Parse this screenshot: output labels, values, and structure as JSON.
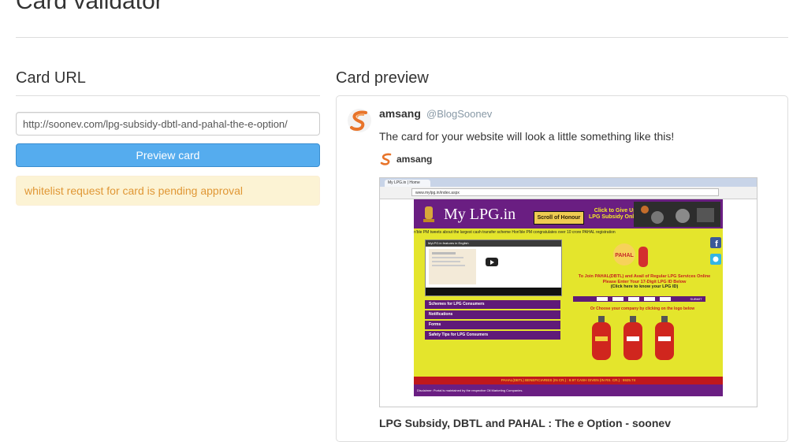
{
  "page": {
    "title": "Card validator"
  },
  "left": {
    "heading": "Card URL",
    "url_value": "http://soonev.com/lpg-subsidy-dbtl-and-pahal-the-e-option/",
    "preview_button": "Preview card",
    "alert_text": "whitelist request for card is pending approval"
  },
  "right": {
    "heading": "Card preview",
    "card": {
      "author_name": "amsang",
      "author_handle": "@BlogSoonev",
      "tweet_text": "The card for your website will look a little something like this!",
      "site_name": "amsang",
      "title": "LPG Subsidy, DBTL and PAHAL : The e Option - soonev"
    }
  },
  "screenshot": {
    "tab_title": "My LPG.in | Home",
    "url": "www.mylpg.in/index.aspx",
    "logo_text": "My LPG.in",
    "scroll_button": "Scroll of Honour",
    "giveup_line1": "Click to Give Up",
    "giveup_line2": "LPG Subsidy Online",
    "ticker": "n'ble PM tweets about the largest cash transfer scheme          Hon'ble PM congratulates over 10 crore PAHAL registration",
    "video_title": "MyLPG.in features in English",
    "menu": [
      "Schemes for LPG Consumers",
      "Notifications",
      "Forms",
      "Safety Tips for LPG Consumers"
    ],
    "pahal_label": "PAHAL",
    "info_line1": "To Join PAHAL(DBTL) and Avail of Regular LPG Services Online",
    "info_line2": "Please Enter Your 17-Digit LPG ID Below",
    "info_line3": "(Click here to know your LPG ID)",
    "submit": "SUBMIT",
    "choose_text": "Or Choose your company by clicking on the logo below",
    "footer": "PAHAL(DBTL) BENEFICIARIES (IN CR.) : 8.97        CASH GIVEN (IN RS. CR.) : 5925.74",
    "footer2": "Disclaimer: Portal is maintained by the respective Oil Marketing Companies."
  },
  "colors": {
    "accent": "#55acee",
    "alert_bg": "#fcf3d4",
    "alert_text": "#e09735",
    "brand_orange": "#e8742a"
  },
  "icons": [
    "soonev-logo-icon",
    "facebook-icon",
    "twitter-icon",
    "play-icon"
  ]
}
